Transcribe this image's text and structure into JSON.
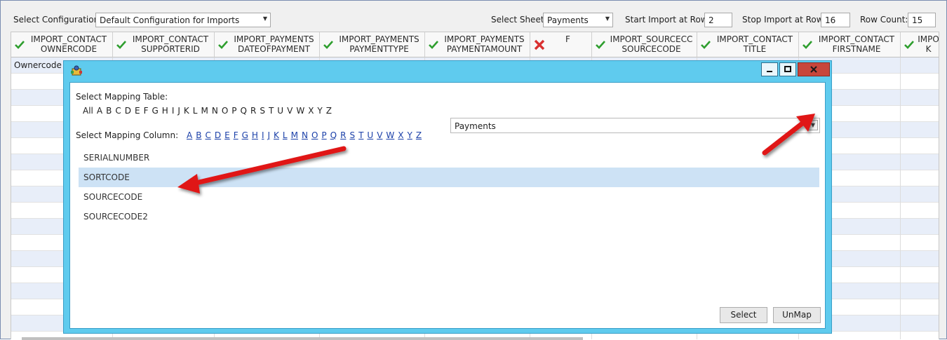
{
  "toolbar": {
    "select_configuration_label": "Select Configuration",
    "configuration_value": "Default Configuration for Imports",
    "select_sheet_label": "Select Sheet",
    "sheet_value": "Payments",
    "start_row_label": "Start Import at Row:",
    "start_row_value": "2",
    "stop_row_label": "Stop Import at Row:",
    "stop_row_value": "16",
    "row_count_label": "Row Count:",
    "row_count_value": "15"
  },
  "grid": {
    "columns": [
      {
        "line1": "IMPORT_CONTACT",
        "line2": "OWNERCODE",
        "status": "mapped"
      },
      {
        "line1": "IMPORT_CONTACT",
        "line2": "SUPPORTERID",
        "status": "mapped"
      },
      {
        "line1": "IMPORT_PAYMENTS",
        "line2": "DATEOFPAYMENT",
        "status": "mapped"
      },
      {
        "line1": "IMPORT_PAYMENTS",
        "line2": "PAYMENTTYPE",
        "status": "mapped"
      },
      {
        "line1": "IMPORT_PAYMENTS",
        "line2": "PAYMENTAMOUNT",
        "status": "mapped"
      },
      {
        "line1": "F",
        "line2": "",
        "status": "unmapped"
      },
      {
        "line1": "IMPORT_SOURCECC",
        "line2": "SOURCECODE",
        "status": "mapped"
      },
      {
        "line1": "IMPORT_CONTACT",
        "line2": "TITLE",
        "status": "mapped"
      },
      {
        "line1": "IMPORT_CONTACT",
        "line2": "FIRSTNAME",
        "status": "mapped"
      },
      {
        "line1": "IMPO",
        "line2": "K",
        "status": "mapped"
      }
    ],
    "first_cell": "Ownercode"
  },
  "dialog": {
    "mapping_table_label": "Select Mapping Table:",
    "table_letters": [
      "All",
      "A",
      "B",
      "C",
      "D",
      "E",
      "F",
      "G",
      "H",
      "I",
      "J",
      "K",
      "L",
      "M",
      "N",
      "O",
      "P",
      "Q",
      "R",
      "S",
      "T",
      "U",
      "V",
      "W",
      "X",
      "Y",
      "Z"
    ],
    "mapping_table_value": "Payments",
    "mapping_column_label": "Select Mapping Column:",
    "column_letters": [
      "A",
      "B",
      "C",
      "D",
      "E",
      "F",
      "G",
      "H",
      "I",
      "J",
      "K",
      "L",
      "M",
      "N",
      "O",
      "P",
      "Q",
      "R",
      "S",
      "T",
      "U",
      "V",
      "W",
      "X",
      "Y",
      "Z"
    ],
    "columns": [
      {
        "label": "SERIALNUMBER",
        "selected": false
      },
      {
        "label": "SORTCODE",
        "selected": true
      },
      {
        "label": "SOURCECODE",
        "selected": false
      },
      {
        "label": "SOURCECODE2",
        "selected": false
      }
    ],
    "select_button": "Select",
    "unmap_button": "UnMap"
  },
  "colors": {
    "dialog_frame": "#5fcbee",
    "selected_row": "#cde2f5",
    "alt_row": "#e8eef9",
    "close_button": "#c8463b",
    "link": "#1a3fa8",
    "annotation_arrow": "#e01515",
    "mapped_icon": "#2e9e2e",
    "unmapped_icon": "#d93030"
  },
  "icons": {
    "mapped": "checkmark-icon",
    "unmapped": "x-icon",
    "dialog": "app-icon",
    "minimize": "minimize-icon",
    "maximize": "maximize-icon",
    "close": "close-icon",
    "dropdown": "chevron-down-icon"
  }
}
